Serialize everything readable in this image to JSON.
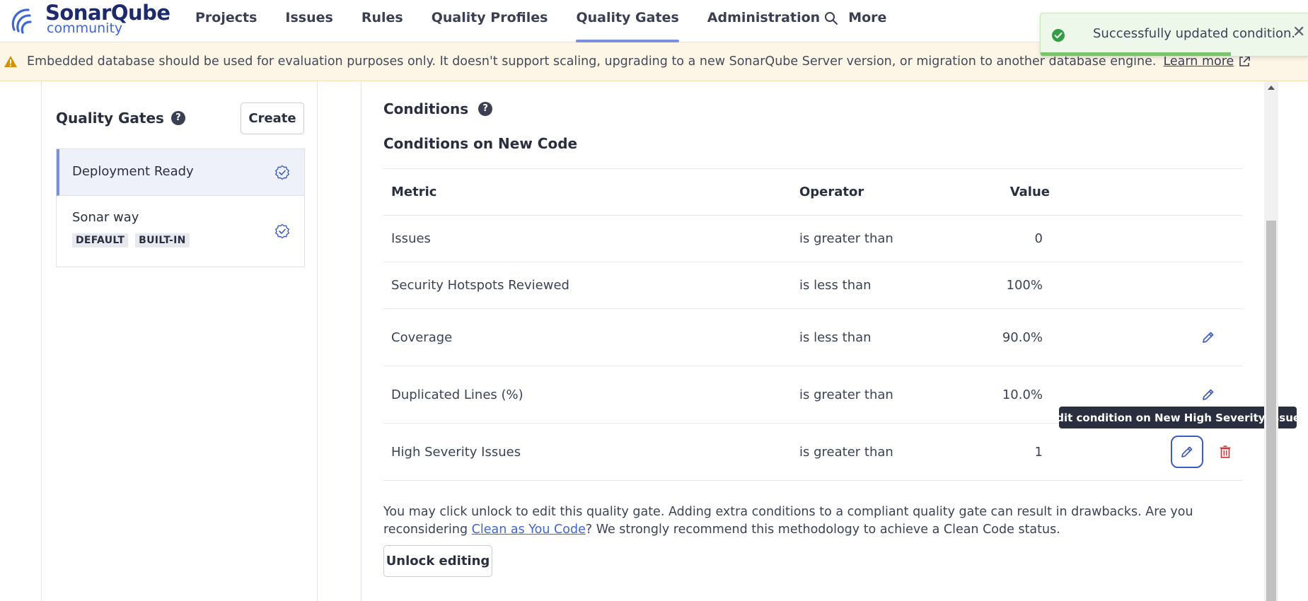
{
  "brand": {
    "name": "SonarQube",
    "edition": "community"
  },
  "nav": {
    "items": [
      "Projects",
      "Issues",
      "Rules",
      "Quality Profiles",
      "Quality Gates",
      "Administration",
      "More"
    ],
    "active": "Quality Gates"
  },
  "banner": {
    "message": "Embedded database should be used for evaluation purposes only. It doesn't support scaling, upgrading to a new SonarQube Server version, or migration to another database engine.",
    "link": "Learn more"
  },
  "toast": {
    "message": "Successfully updated condition.",
    "close": "✕",
    "progress": 0.71
  },
  "sidebar": {
    "title": "Quality Gates",
    "help": "?",
    "create_label": "Create",
    "gates": [
      {
        "name": "Deployment Ready",
        "tags": []
      },
      {
        "name": "Sonar way",
        "tags": [
          "DEFAULT",
          "BUILT-IN"
        ]
      }
    ]
  },
  "conditions": {
    "title": "Conditions",
    "help": "?",
    "subtitle": "Conditions on New Code",
    "headers": {
      "metric": "Metric",
      "operator": "Operator",
      "value": "Value"
    },
    "rows": [
      {
        "metric": "Issues",
        "operator": "is greater than",
        "value": "0"
      },
      {
        "metric": "Security Hotspots Reviewed",
        "operator": "is less than",
        "value": "100%"
      },
      {
        "metric": "Coverage",
        "operator": "is less than",
        "value": "90.0%"
      },
      {
        "metric": "Duplicated Lines (%)",
        "operator": "is greater than",
        "value": "10.0%"
      },
      {
        "metric": "High Severity Issues",
        "operator": "is greater than",
        "value": "1"
      }
    ],
    "tooltip": "Edit condition on New High Severity Issues",
    "note_before": "You may click unlock to edit this quality gate. Adding extra conditions to a compliant quality gate can result in drawbacks. Are you reconsidering ",
    "note_link": "Clean as You Code",
    "note_after": "? We strongly recommend this methodology to achieve a Clean Code status.",
    "unlock_label": "Unlock editing"
  },
  "colors": {
    "accent": "#7b8fdc",
    "link": "#3e66d6",
    "danger": "#d03a3a",
    "success": "#2f9e44",
    "warning": "#d49000"
  }
}
